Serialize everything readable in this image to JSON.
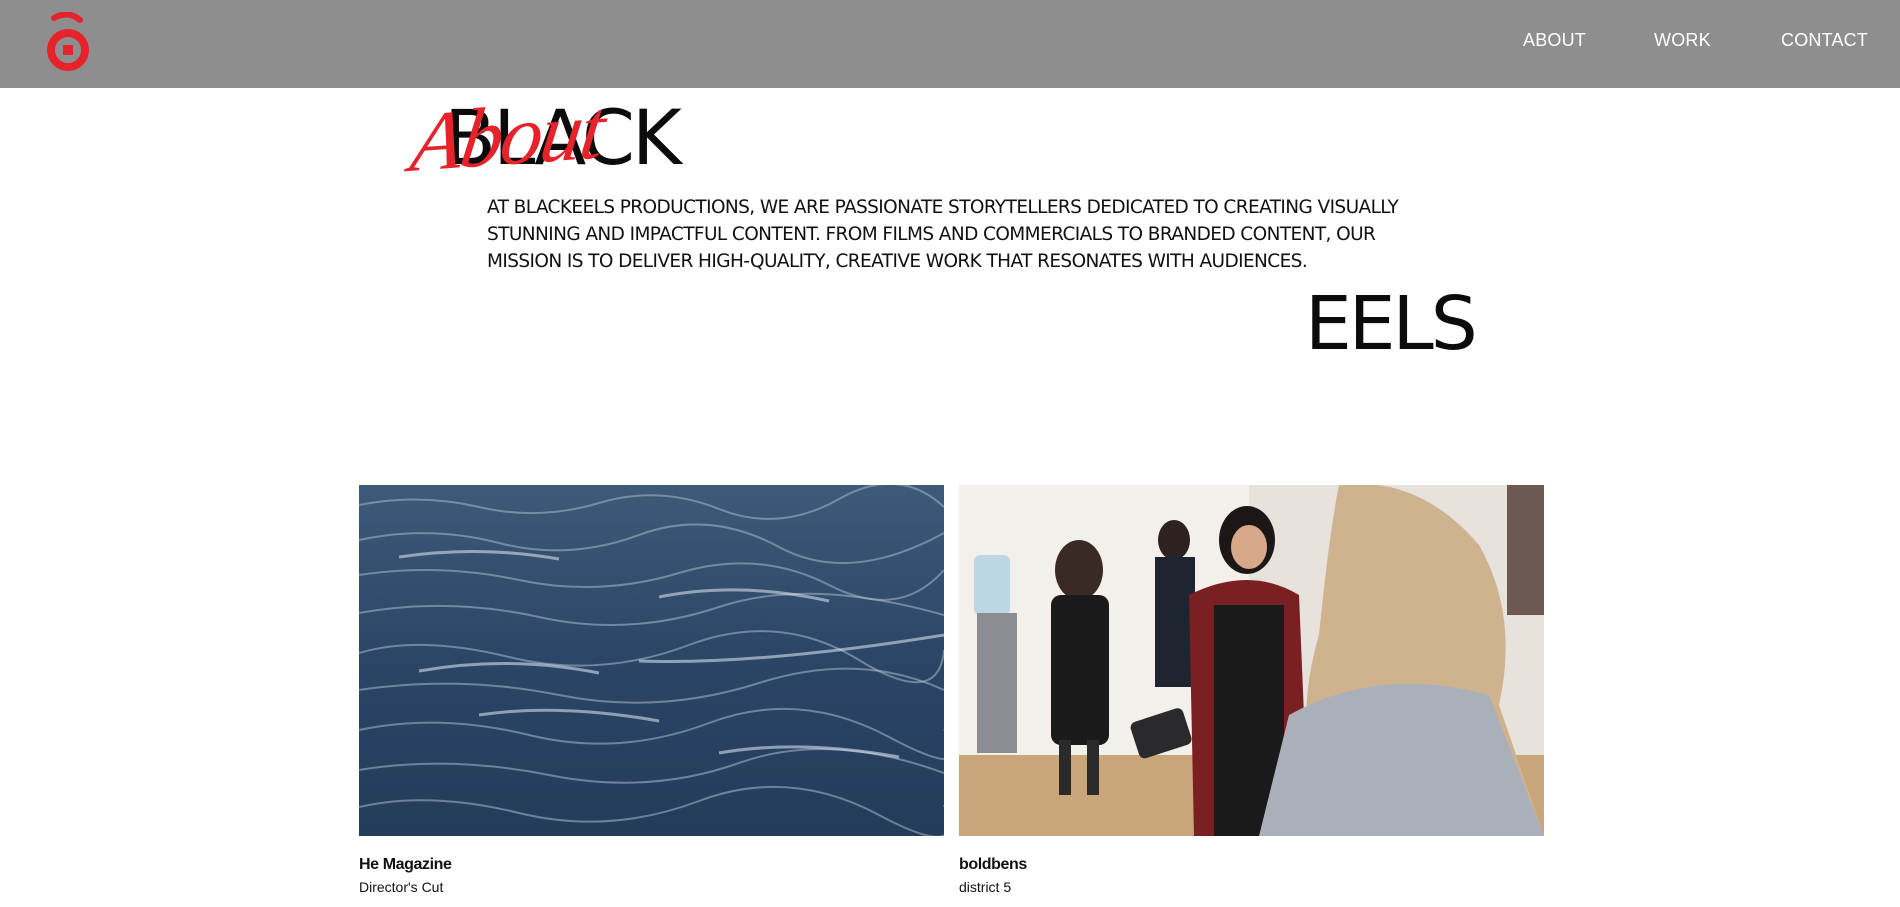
{
  "header": {
    "logo_name": "blackeels-logo",
    "brand_color": "#e6232b",
    "background": "#8e8e8e",
    "nav": [
      {
        "label": "ABOUT"
      },
      {
        "label": "WORK"
      },
      {
        "label": "CONTACT"
      }
    ]
  },
  "hero": {
    "word_left": "BLACK",
    "script_word": "About",
    "word_right": "EELS",
    "paragraph": "AT BLACKEELS PRODUCTIONS, WE ARE PASSIONATE STORYTELLERS DEDICATED TO CREATING VISUALLY STUNNING AND IMPACTFUL CONTENT. FROM FILMS AND COMMERCIALS TO BRANDED CONTENT, OUR MISSION IS TO DELIVER HIGH-QUALITY, CREATIVE WORK THAT RESONATES WITH AUDIENCES."
  },
  "work": {
    "items": [
      {
        "title": "He Magazine",
        "subtitle": "Director's Cut",
        "image": "ocean-waves"
      },
      {
        "title": "boldbens",
        "subtitle": "district 5",
        "image": "people-greeting-in-office"
      }
    ]
  }
}
